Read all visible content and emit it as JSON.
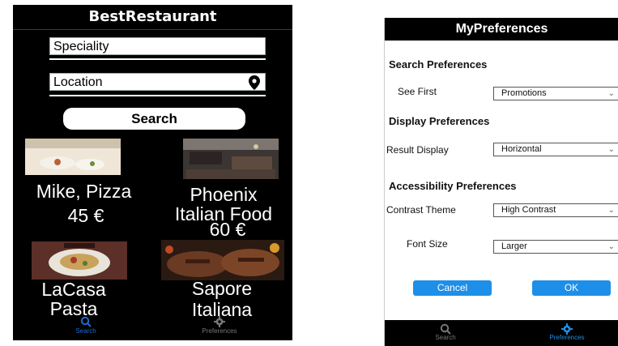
{
  "left": {
    "title": "BestRestaurant",
    "speciality_placeholder": "Speciality",
    "location_placeholder": "Location",
    "search_button": "Search",
    "restaurants": [
      {
        "name": "Mike, Pizza",
        "price": "45 €"
      },
      {
        "name": "Phoenix\nItalian Food",
        "price": "60 €"
      },
      {
        "name": "LaCasa\nPasta"
      },
      {
        "name": "Sapore\nItaliana"
      }
    ],
    "tabs": [
      {
        "label": "Search",
        "icon": "search-icon",
        "active": true
      },
      {
        "label": "Preferences",
        "icon": "gear-icon",
        "active": false
      }
    ],
    "colors": {
      "background": "#000000",
      "active_tab": "#1e6ad6",
      "inactive_tab": "#777777"
    }
  },
  "right": {
    "title": "MyPreferences",
    "search_preferences": {
      "heading": "Search Preferences",
      "see_first_label": "See First",
      "see_first_value": "Promotions"
    },
    "display_preferences": {
      "heading": "Display Preferences",
      "result_display_label": "Result Display",
      "result_display_value": "Horizontal"
    },
    "accessibility_preferences": {
      "heading": "Accessibility Preferences",
      "contrast_theme_label": "Contrast Theme",
      "contrast_theme_value": "High Contrast",
      "font_size_label": "Font Size",
      "font_size_value": "Larger"
    },
    "cancel_button": "Cancel",
    "ok_button": "OK",
    "tabs": [
      {
        "label": "Search",
        "icon": "search-icon",
        "active": false
      },
      {
        "label": "Preferences",
        "icon": "gear-icon",
        "active": true
      }
    ],
    "colors": {
      "accent": "#1e8fe8",
      "tabbar": "#000000"
    }
  }
}
